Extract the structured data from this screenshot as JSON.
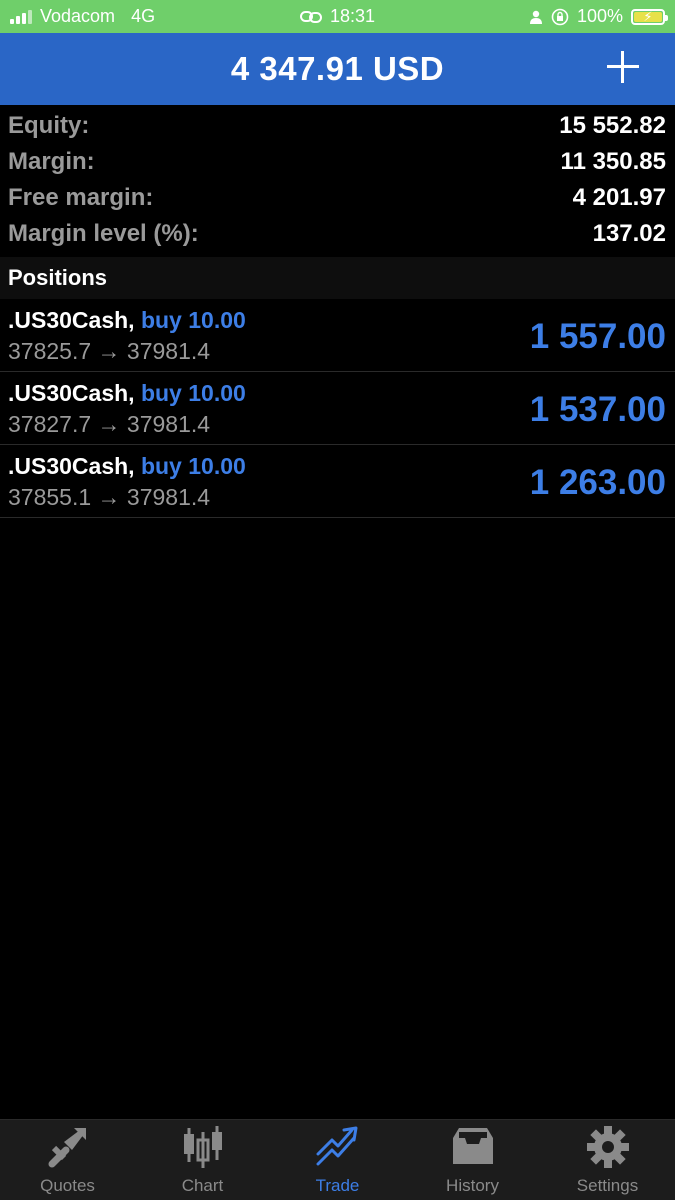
{
  "status": {
    "carrier": "Vodacom",
    "network": "4G",
    "time": "18:31",
    "battery": "100%"
  },
  "header": {
    "balance": "4 347.91 USD"
  },
  "summary": [
    {
      "label": "Equity:",
      "value": "15 552.82"
    },
    {
      "label": "Margin:",
      "value": "11 350.85"
    },
    {
      "label": "Free margin:",
      "value": "4 201.97"
    },
    {
      "label": "Margin level (%):",
      "value": "137.02"
    }
  ],
  "positions_title": "Positions",
  "positions": [
    {
      "symbol": ".US30Cash,",
      "type": "buy 10.00",
      "prices": "37825.7 → 37981.4",
      "profit": "1 557.00"
    },
    {
      "symbol": ".US30Cash,",
      "type": "buy 10.00",
      "prices": "37827.7 → 37981.4",
      "profit": "1 537.00"
    },
    {
      "symbol": ".US30Cash,",
      "type": "buy 10.00",
      "prices": "37855.1 → 37981.4",
      "profit": "1 263.00"
    }
  ],
  "tabs": [
    {
      "label": "Quotes",
      "icon": "quotes-icon",
      "active": false
    },
    {
      "label": "Chart",
      "icon": "candlestick-icon",
      "active": false
    },
    {
      "label": "Trade",
      "icon": "trade-icon",
      "active": true
    },
    {
      "label": "History",
      "icon": "inbox-icon",
      "active": false
    },
    {
      "label": "Settings",
      "icon": "gear-icon",
      "active": false
    }
  ],
  "colors": {
    "status_bar": "#6fcf6a",
    "header": "#2a66c6",
    "accent": "#3d7ee6",
    "background": "#000000"
  }
}
